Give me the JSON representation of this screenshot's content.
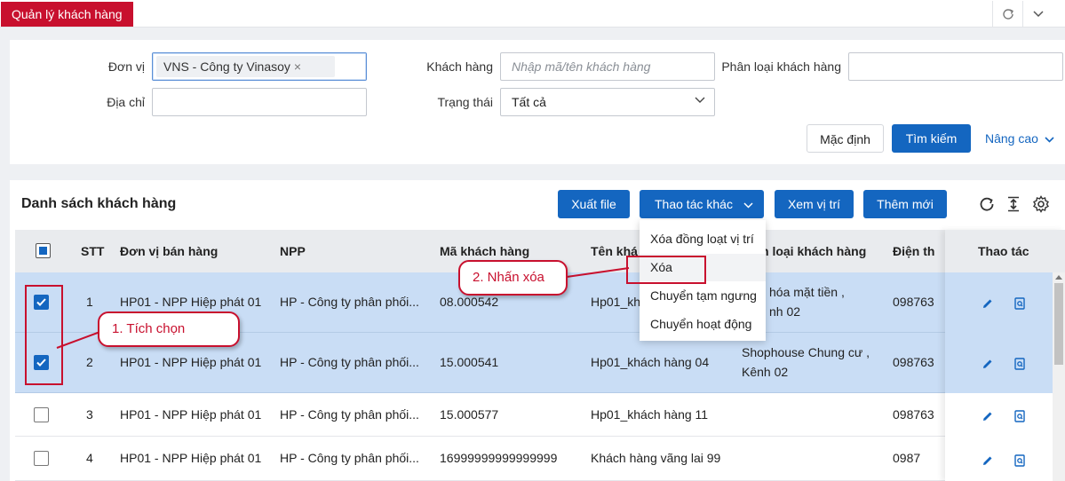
{
  "topbar": {
    "active_tab": "Quản lý khách hàng",
    "refresh_icon": "refresh-icon",
    "collapse_icon": "chevron-down-icon"
  },
  "filters": {
    "don_vi_label": "Đơn vị",
    "don_vi_chip": "VNS - Công ty Vinasoy",
    "dia_chi_label": "Địa chỉ",
    "dia_chi_value": "",
    "khach_hang_label": "Khách hàng",
    "khach_hang_placeholder": "Nhập mã/tên khách hàng",
    "trang_thai_label": "Trạng thái",
    "trang_thai_value": "Tất cả",
    "phan_loai_label": "Phân loại khách hàng",
    "phan_loai_value": "",
    "default_button": "Mặc định",
    "search_button": "Tìm kiếm",
    "advanced_link": "Nâng cao"
  },
  "list": {
    "title": "Danh sách khách hàng",
    "toolbar": {
      "export": "Xuất file",
      "other_actions": "Thao tác khác",
      "view_location": "Xem vị trí",
      "add_new": "Thêm mới"
    },
    "columns": [
      "STT",
      "Đơn vị bán hàng",
      "NPP",
      "Mã khách hàng",
      "Tên khá",
      "n loại khách hàng",
      "Điện th",
      "Thao tác"
    ],
    "rows": [
      {
        "selected": true,
        "stt": "1",
        "don_vi": "HP01 - NPP Hiệp phát 01",
        "npp": "HP - Công ty phân phối...",
        "ma": "08.000542",
        "ten": "Hp01_kh",
        "phan_loai_1": "hóa mặt tiền ,",
        "phan_loai_2": "nh 02",
        "dien_thoai": "098763"
      },
      {
        "selected": true,
        "stt": "2",
        "don_vi": "HP01 - NPP Hiệp phát 01",
        "npp": "HP - Công ty phân phối...",
        "ma": "15.000541",
        "ten": "Hp01_khách hàng 04",
        "phan_loai_1": "Shophouse Chung cư ,",
        "phan_loai_2": "Kênh 02",
        "dien_thoai": "098763"
      },
      {
        "selected": false,
        "stt": "3",
        "don_vi": "HP01 - NPP Hiệp phát 01",
        "npp": "HP - Công ty phân phối...",
        "ma": "15.000577",
        "ten": "Hp01_khách hàng 11",
        "phan_loai_1": "",
        "phan_loai_2": "",
        "dien_thoai": "098763"
      },
      {
        "selected": false,
        "stt": "4",
        "don_vi": "HP01 - NPP Hiệp phát 01",
        "npp": "HP - Công ty phân phối...",
        "ma": "16999999999999999",
        "ten": "Khách hàng vãng lai 99",
        "phan_loai_1": "",
        "phan_loai_2": "",
        "dien_thoai": "0987"
      }
    ]
  },
  "dropdown": {
    "items": [
      "Xóa đồng loạt vị trí",
      "Xóa",
      "Chuyển tạm ngưng",
      "Chuyển hoạt động"
    ]
  },
  "annotations": {
    "step1": "1. Tích chọn",
    "step2": "2. Nhấn xóa"
  },
  "colors": {
    "brand_red": "#c8102e",
    "primary_blue": "#1466c0",
    "selected_row": "#c9ddf5"
  }
}
